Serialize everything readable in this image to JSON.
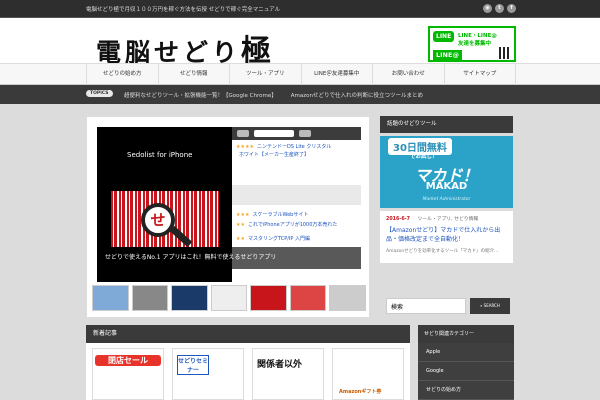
{
  "topbar": {
    "tagline": "電脳せどり極で月収１００万円を稼ぐ方法を伝授 せどりで稼ぐ完全マニュアル"
  },
  "header": {
    "logo_text": "電脳せどり",
    "logo_big": "極",
    "line_banner": {
      "badge": "LINE",
      "text1": "LINE・LINE@",
      "text2": "友達を募集中",
      "badge2": "LINE@"
    }
  },
  "nav": {
    "items": [
      "せどりの始め方",
      "せどり情報",
      "ツール・アプリ",
      "LINE＠友達募集中",
      "お問い合わせ",
      "サイトマップ"
    ]
  },
  "ticker": {
    "label": "TOPICS",
    "items": [
      "超便利なせどりツール・拡張機能一覧！【Google Chrome】",
      "Amazonせどりで仕入れの判断に役立つツールまとめ"
    ]
  },
  "slider": {
    "app_name": "Sedolist for iPhone",
    "lens_char": "せ",
    "caption": "せどりで使えるNo.1 アプリはこれ！無料で使えるせどりアプリ",
    "products": [
      {
        "stars": "★★★★",
        "name": "ニンテンドーDS Lite クリスタル"
      },
      {
        "stars": "",
        "name": "ホワイト【メーカー生産終了】"
      },
      {
        "stars": "★★★",
        "name": "スケーラブルWebサイト"
      },
      {
        "stars": "★★",
        "name": "これでiPhoneアプリが1000万本売れた"
      },
      {
        "stars": "★★",
        "name": "マスタリングTCP/IP 入門編"
      }
    ]
  },
  "sidebar": {
    "head": "話題のせどりツール",
    "makad": {
      "top": "30日間無料",
      "sub": "でお試し！",
      "big": "マカド！",
      "en": "MAKAD",
      "en2": "Market Administrator"
    },
    "post": {
      "date": "2016-6-7",
      "categories": "ツール・アプリ, せどり情報",
      "title": "【Amazonせどり】マカドで仕入れから出品・価格改定まで全自動化！",
      "excerpt": "Amazonせどりを効率化するツール「マカド」の紹介…"
    },
    "search": {
      "value": "検索",
      "button": "SEARCH"
    },
    "categories_head": "せどり関連カテゴリー",
    "categories": [
      "Apple",
      "Google",
      "せどりの始め方"
    ]
  },
  "section": {
    "head": "新着記事",
    "cards": [
      {
        "label": "閉店セール"
      },
      {
        "label": "せどりセミナー"
      },
      {
        "label": "関係者以外"
      },
      {
        "label": "Amazonギフト券"
      }
    ]
  },
  "colors": {
    "dark": "#3a3a3a",
    "accent_red": "#c7151b",
    "line_green": "#00b900",
    "makad_blue": "#2ba3c8",
    "link_blue": "#1f55c0"
  }
}
